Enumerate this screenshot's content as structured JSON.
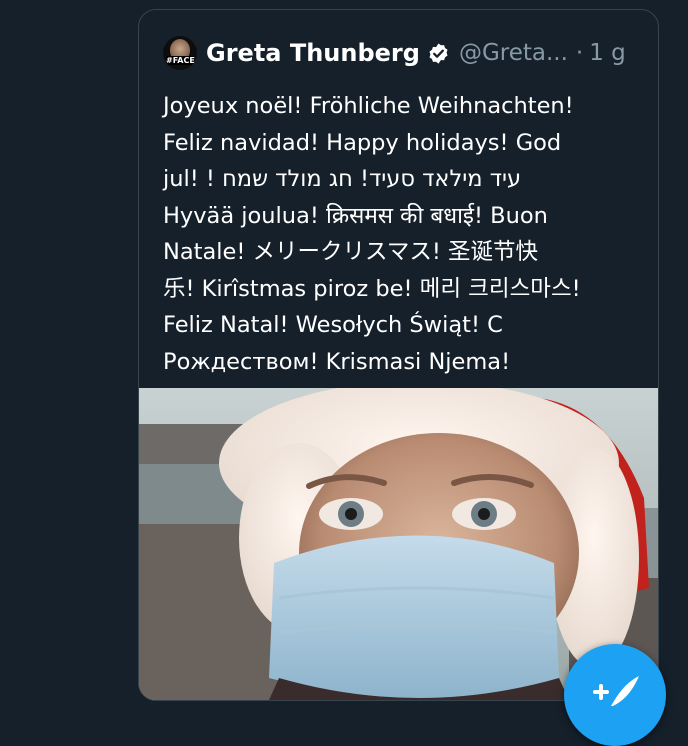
{
  "tweet": {
    "author": {
      "name": "Greta Thunberg",
      "handle": "@Greta...",
      "verified": true,
      "avatar_tag": "#FACE"
    },
    "separator": "·",
    "time": "1 g",
    "text_lines": [
      "Joyeux noël! Fröhliche Weihnachten!",
      "Feliz navidad! Happy holidays! God",
      "jul! ! עיד מילאד סעיד! חג מולד שמח",
      "Hyvää joulua! क्रिसमस की बधाई! Buon",
      "Natale! メリークリスマス! 圣诞节快",
      "乐! Kirîstmas piroz be! 메리 크리스마스!",
      "Feliz Natal! Wesołych Świąt! С",
      "Рождеством! Krismasi Njema!"
    ]
  },
  "colors": {
    "background": "#15202b",
    "border": "#38444d",
    "secondary_text": "#8899a6",
    "accent": "#1da1f2"
  },
  "icons": {
    "verified": "verified-badge-icon",
    "compose": "compose-tweet-icon"
  }
}
